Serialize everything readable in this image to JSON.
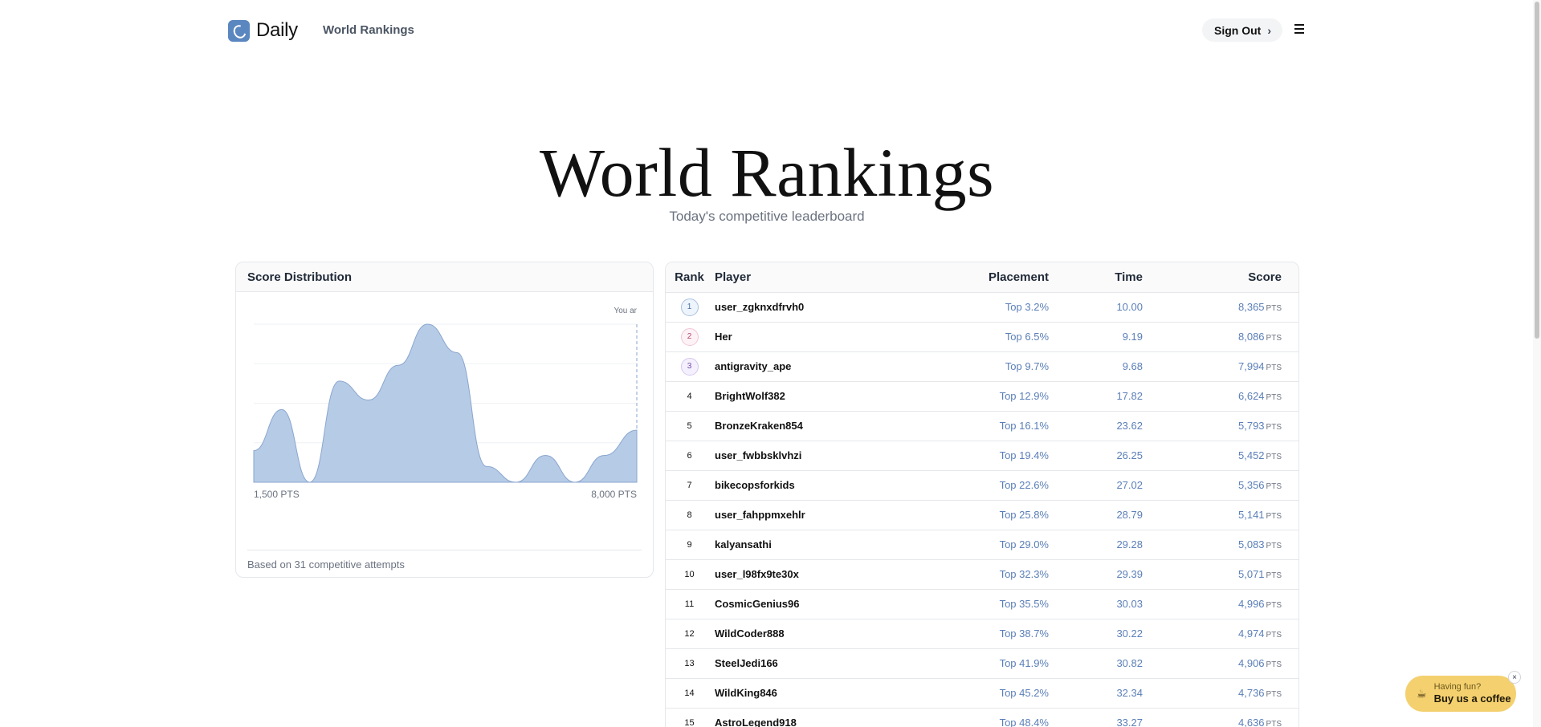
{
  "header": {
    "brand": "Daily",
    "nav_link": "World Rankings",
    "sign_out": "Sign Out"
  },
  "hero": {
    "title": "World Rankings",
    "subtitle": "Today's competitive leaderboard"
  },
  "distribution": {
    "title": "Score Distribution",
    "marker_label": "You ar",
    "x_min_label": "1,500 PTS",
    "x_max_label": "8,000 PTS",
    "footer": "Based on 31 competitive attempts"
  },
  "chart_data": {
    "type": "area",
    "title": "Score Distribution",
    "x": [
      1500,
      1975,
      2450,
      2950,
      3450,
      3950,
      4450,
      4950,
      5450,
      5950,
      6450,
      6950,
      7450,
      8000
    ],
    "values": [
      0.2,
      0.46,
      0.0,
      0.64,
      0.52,
      0.74,
      1.0,
      0.82,
      0.1,
      0.0,
      0.17,
      0.0,
      0.17,
      0.33
    ],
    "xlim": [
      1500,
      8000
    ],
    "ylim": [
      0,
      1
    ],
    "marker_x": 8000,
    "grid": true,
    "color": "#b6cbe6",
    "stroke": "#8aa6cf"
  },
  "table": {
    "headers": {
      "rank": "Rank",
      "player": "Player",
      "placement": "Placement",
      "time": "Time",
      "score": "Score"
    },
    "pts_label": "PTS",
    "rows": [
      {
        "rank": "1",
        "player": "user_zgknxdfrvh0",
        "placement": "Top 3.2%",
        "time": "10.00",
        "score": "8,365"
      },
      {
        "rank": "2",
        "player": "Her",
        "placement": "Top 6.5%",
        "time": "9.19",
        "score": "8,086"
      },
      {
        "rank": "3",
        "player": "antigravity_ape",
        "placement": "Top 9.7%",
        "time": "9.68",
        "score": "7,994"
      },
      {
        "rank": "4",
        "player": "BrightWolf382",
        "placement": "Top 12.9%",
        "time": "17.82",
        "score": "6,624"
      },
      {
        "rank": "5",
        "player": "BronzeKraken854",
        "placement": "Top 16.1%",
        "time": "23.62",
        "score": "5,793"
      },
      {
        "rank": "6",
        "player": "user_fwbbsklvhzi",
        "placement": "Top 19.4%",
        "time": "26.25",
        "score": "5,452"
      },
      {
        "rank": "7",
        "player": "bikecopsforkids",
        "placement": "Top 22.6%",
        "time": "27.02",
        "score": "5,356"
      },
      {
        "rank": "8",
        "player": "user_fahppmxehlr",
        "placement": "Top 25.8%",
        "time": "28.79",
        "score": "5,141"
      },
      {
        "rank": "9",
        "player": "kalyansathi",
        "placement": "Top 29.0%",
        "time": "29.28",
        "score": "5,083"
      },
      {
        "rank": "10",
        "player": "user_l98fx9te30x",
        "placement": "Top 32.3%",
        "time": "29.39",
        "score": "5,071"
      },
      {
        "rank": "11",
        "player": "CosmicGenius96",
        "placement": "Top 35.5%",
        "time": "30.03",
        "score": "4,996"
      },
      {
        "rank": "12",
        "player": "WildCoder888",
        "placement": "Top 38.7%",
        "time": "30.22",
        "score": "4,974"
      },
      {
        "rank": "13",
        "player": "SteelJedi166",
        "placement": "Top 41.9%",
        "time": "30.82",
        "score": "4,906"
      },
      {
        "rank": "14",
        "player": "WildKing846",
        "placement": "Top 45.2%",
        "time": "32.34",
        "score": "4,736"
      },
      {
        "rank": "15",
        "player": "AstroLegend918",
        "placement": "Top 48.4%",
        "time": "33.27",
        "score": "4,636"
      }
    ]
  },
  "coffee": {
    "line1": "Having fun?",
    "line2": "Buy us a coffee",
    "close": "×"
  },
  "icons": {
    "logo": "daily-logo-icon",
    "chevron": "chevron-right-icon",
    "menu": "hamburger-menu-icon",
    "coffee": "coffee-cup-icon"
  }
}
